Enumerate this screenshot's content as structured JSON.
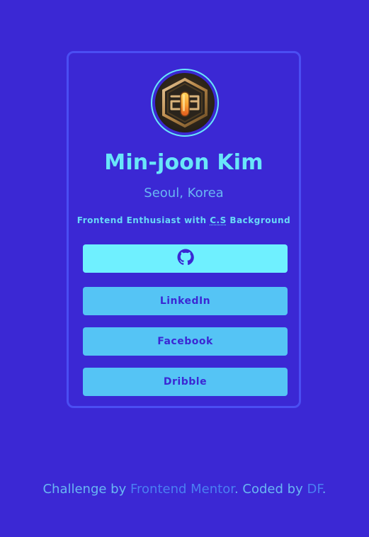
{
  "profile": {
    "avatar_icon": "2023-hexagon-logo-icon",
    "name": "Min-joon Kim",
    "location": "Seoul, Korea",
    "bio_prefix": "Frontend Enthusiast with ",
    "bio_abbr": "C.S",
    "bio_suffix": " Background"
  },
  "links": {
    "github_icon": "github-icon",
    "linkedin_label": "LinkedIn",
    "facebook_label": "Facebook",
    "dribbble_label": "Dribble"
  },
  "footer": {
    "prefix": "Challenge by ",
    "challenge_link": "Frontend Mentor",
    "middle": ". Coded by ",
    "author_link": "DF",
    "suffix": "."
  },
  "colors": {
    "background": "#3b28d4",
    "accent_cyan": "#69e6f9",
    "button_primary": "#6ff0ff",
    "button_secondary": "#55c4f5",
    "link_blue": "#4a7ff2"
  }
}
